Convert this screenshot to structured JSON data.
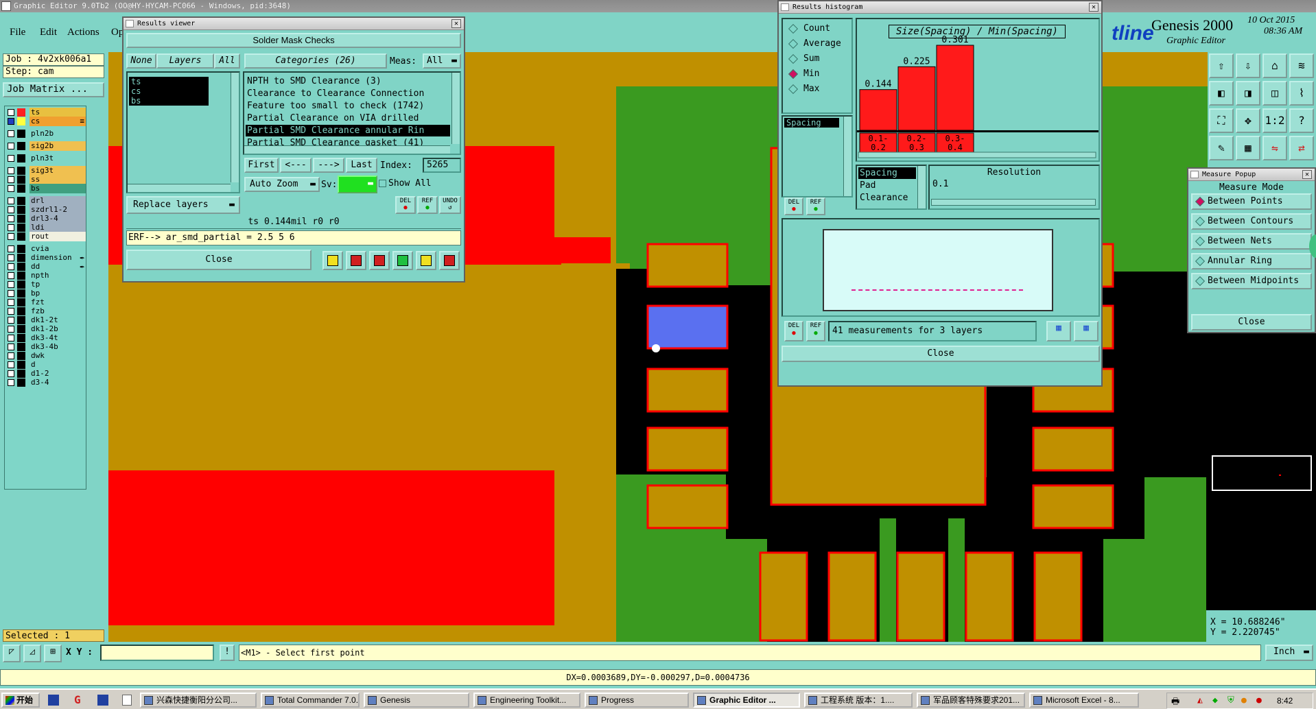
{
  "window_title": "Graphic Editor 9.0Tb2 (OO@HY-HYCAM-PC066 - Windows, pid:3648)",
  "menu": [
    "File",
    "Edit",
    "Actions",
    "Op"
  ],
  "brand": {
    "name": "Genesis 2000",
    "sub": "Graphic Editor",
    "logo": "tline",
    "date": "10 Oct 2015",
    "time": "08:36 AM"
  },
  "job": {
    "job": "Job : 4v2xk006a1",
    "step": "Step: cam",
    "matrix_btn": "Job Matrix ..."
  },
  "layers": [
    {
      "name": "ts",
      "color": "#e8c040",
      "sq": "#ff2020",
      "sel": "blue"
    },
    {
      "name": "cs",
      "color": "#f0a030",
      "sq": "#000",
      "sel": "yellow",
      "mark": "≡"
    },
    {
      "name": "pln2b",
      "color": "#7fd6c8",
      "sq": "#000"
    },
    {
      "name": "sig2b",
      "color": "#f0c050",
      "sq": "#000"
    },
    {
      "name": "pln3t",
      "color": "#7fd6c8",
      "sq": "#000"
    },
    {
      "name": "sig3t",
      "color": "#f0c050",
      "sq": "#000"
    },
    {
      "name": "ss",
      "color": "#f0c050",
      "sq": "#000"
    },
    {
      "name": "bs",
      "color": "#40a080",
      "sq": "#000"
    },
    {
      "name": "drl",
      "color": "#a0b0c0",
      "sq": "#000"
    },
    {
      "name": "szdrl1-2",
      "color": "#a0b0c0",
      "sq": "#000"
    },
    {
      "name": "drl3-4",
      "color": "#a0b0c0",
      "sq": "#000"
    },
    {
      "name": "ldi",
      "color": "#a0b0c0",
      "sq": "#000"
    },
    {
      "name": "rout",
      "color": "#f0f0e0",
      "sq": "#000"
    },
    {
      "name": "cvia",
      "color": "#7fd6c8",
      "sq": "#000"
    },
    {
      "name": "dimension",
      "color": "#7fd6c8",
      "sq": "#000",
      "mark": "✒"
    },
    {
      "name": "dd",
      "color": "#7fd6c8",
      "sq": "#000",
      "mark": "✒"
    },
    {
      "name": "npth",
      "color": "#7fd6c8",
      "sq": "#000"
    },
    {
      "name": "tp",
      "color": "#7fd6c8",
      "sq": "#000"
    },
    {
      "name": "bp",
      "color": "#7fd6c8",
      "sq": "#000"
    },
    {
      "name": "fzt",
      "color": "#7fd6c8",
      "sq": "#000"
    },
    {
      "name": "fzb",
      "color": "#7fd6c8",
      "sq": "#000"
    },
    {
      "name": "dk1-2t",
      "color": "#7fd6c8",
      "sq": "#000"
    },
    {
      "name": "dk1-2b",
      "color": "#7fd6c8",
      "sq": "#000"
    },
    {
      "name": "dk3-4t",
      "color": "#7fd6c8",
      "sq": "#000"
    },
    {
      "name": "dk3-4b",
      "color": "#7fd6c8",
      "sq": "#000"
    },
    {
      "name": "dwk",
      "color": "#7fd6c8",
      "sq": "#000"
    },
    {
      "name": "d",
      "color": "#7fd6c8",
      "sq": "#000"
    },
    {
      "name": "d1-2",
      "color": "#7fd6c8",
      "sq": "#000"
    },
    {
      "name": "d3-4",
      "color": "#7fd6c8",
      "sq": "#000"
    }
  ],
  "selected_text": "Selected : 1",
  "results_viewer": {
    "title": "Results viewer",
    "header": "Solder Mask Checks",
    "none_btn": "None",
    "layers_btn": "Layers",
    "all_btn": "All",
    "categories_btn": "Categories (26)",
    "meas_label": "Meas:",
    "meas_value": "All",
    "layer_items": [
      "ts",
      "cs",
      "bs"
    ],
    "categories": [
      "NPTH to SMD Clearance (3)",
      "Clearance to Clearance Connection",
      "Feature too small to check (1742)",
      "Partial Clearance on VIA drilled",
      "Partial SMD Clearance annular Rin",
      "Partial SMD Clearance gasket (41)"
    ],
    "nav": {
      "first": "First",
      "prev": "<---",
      "next": "--->",
      "last": "Last",
      "index_label": "Index:",
      "index_value": "5265"
    },
    "auto_zoom": "Auto Zoom",
    "sv_label": "Sv:",
    "show_all": "Show All",
    "replace_layers": "Replace layers",
    "small_btns": [
      "DEL",
      "REF",
      "UNDO"
    ],
    "status": "ts 0.144mil   r0   r0",
    "erf": "ERF--> ar_smd_partial = 2.5 5 6",
    "close": "Close"
  },
  "histogram": {
    "title": "Results histogram",
    "radios": [
      {
        "label": "Count",
        "on": false
      },
      {
        "label": "Average",
        "on": false
      },
      {
        "label": "Sum",
        "on": false
      },
      {
        "label": "Min",
        "on": true
      },
      {
        "label": "Max",
        "on": false
      }
    ],
    "chart_title": "Size(Spacing) / Min(Spacing)",
    "bar_values": [
      "0.144",
      "0.225",
      "0.301"
    ],
    "bar_bins": [
      "0.1-\n0.2",
      "0.2-\n0.3",
      "0.3-\n0.4"
    ],
    "list1": [
      "Spacing"
    ],
    "list2": [
      "Spacing",
      "Pad",
      "Clearance"
    ],
    "resolution_label": "Resolution",
    "resolution_value": "0.1",
    "small_btns": [
      "DEL",
      "REF"
    ],
    "summary": "41 measurements for 3 layers",
    "close": "Close"
  },
  "measure": {
    "title": "Measure Popup",
    "mode_label": "Measure Mode",
    "modes": [
      {
        "label": "Between Points",
        "on": true
      },
      {
        "label": "Between Contours",
        "on": false
      },
      {
        "label": "Between Nets",
        "on": false
      },
      {
        "label": "Annular Ring",
        "on": false
      },
      {
        "label": "Between Midpoints",
        "on": false
      }
    ],
    "close": "Close"
  },
  "coords": {
    "x": "X = 10.688246\"",
    "y": "Y =  2.220745\""
  },
  "bottom": {
    "xy_label": "X Y :",
    "xy_value": "",
    "prompt": "<M1> - Select first point",
    "unit": "Inch"
  },
  "measure_readout": "DX=0.0003689,DY=-0.000297,D=0.0004736",
  "taskbar": {
    "start": "开始",
    "tasks": [
      {
        "label": "兴森快捷衡阳分公司...",
        "active": false
      },
      {
        "label": "Total Commander 7.0...",
        "active": false
      },
      {
        "label": "Genesis",
        "active": false
      },
      {
        "label": "Engineering Toolkit...",
        "active": false
      },
      {
        "label": "Progress",
        "active": false
      },
      {
        "label": "Graphic Editor ...",
        "active": true
      },
      {
        "label": "工程系统   版本：1....",
        "active": false
      },
      {
        "label": "军品顾客特殊要求201...",
        "active": false
      },
      {
        "label": "Microsoft Excel - 8...",
        "active": false
      }
    ],
    "clock": "8:42"
  },
  "colors": {
    "board_green": "#3a9a20",
    "copper": "#c09000",
    "mask": "#ff0000",
    "teal": "#80d4c6"
  }
}
